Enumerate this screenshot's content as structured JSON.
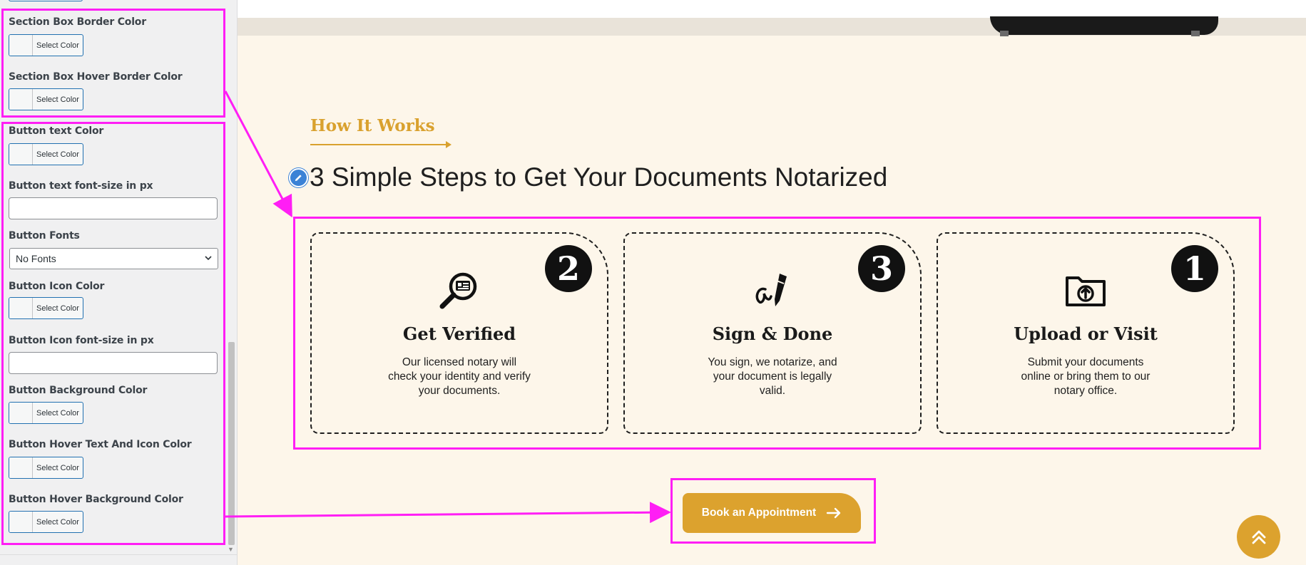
{
  "sidebar": {
    "color_button_label": "Select Color",
    "section_box_border_color": "Section Box Border Color",
    "section_box_hover_border_color": "Section Box Hover Border Color",
    "button_text_color": "Button text Color",
    "button_text_font_size": "Button text font-size in px",
    "button_fonts": "Button Fonts",
    "button_fonts_selected": "No Fonts",
    "button_icon_color": "Button Icon Color",
    "button_icon_font_size": "Button Icon font-size in px",
    "button_background_color": "Button Background Color",
    "button_hover_text_icon_color": "Button Hover Text And Icon Color",
    "button_hover_background_color": "Button Hover Background Color"
  },
  "preview": {
    "eyebrow": "How It Works",
    "heading": "3 Simple Steps to Get Your Documents Notarized",
    "cards": [
      {
        "number": "2",
        "icon": "magnifier-id-card-icon",
        "title": "Get Verified",
        "description": "Our licensed notary will check your identity and verify your documents."
      },
      {
        "number": "3",
        "icon": "signature-pen-icon",
        "title": "Sign & Done",
        "description": "You sign, we notarize, and your document is legally valid."
      },
      {
        "number": "1",
        "icon": "folder-upload-icon",
        "title": "Upload or Visit",
        "description": "Submit your documents online or bring them to our notary office."
      }
    ],
    "cta_label": "Book an Appointment",
    "scroll_top_icon": "double-chevron-up-icon"
  },
  "colors": {
    "accent": "#dca22e",
    "background": "#fdf6ea",
    "annotation": "#ff1ef5",
    "panel_bg": "#f0f0f1",
    "wp_blue": "#2271b1"
  }
}
